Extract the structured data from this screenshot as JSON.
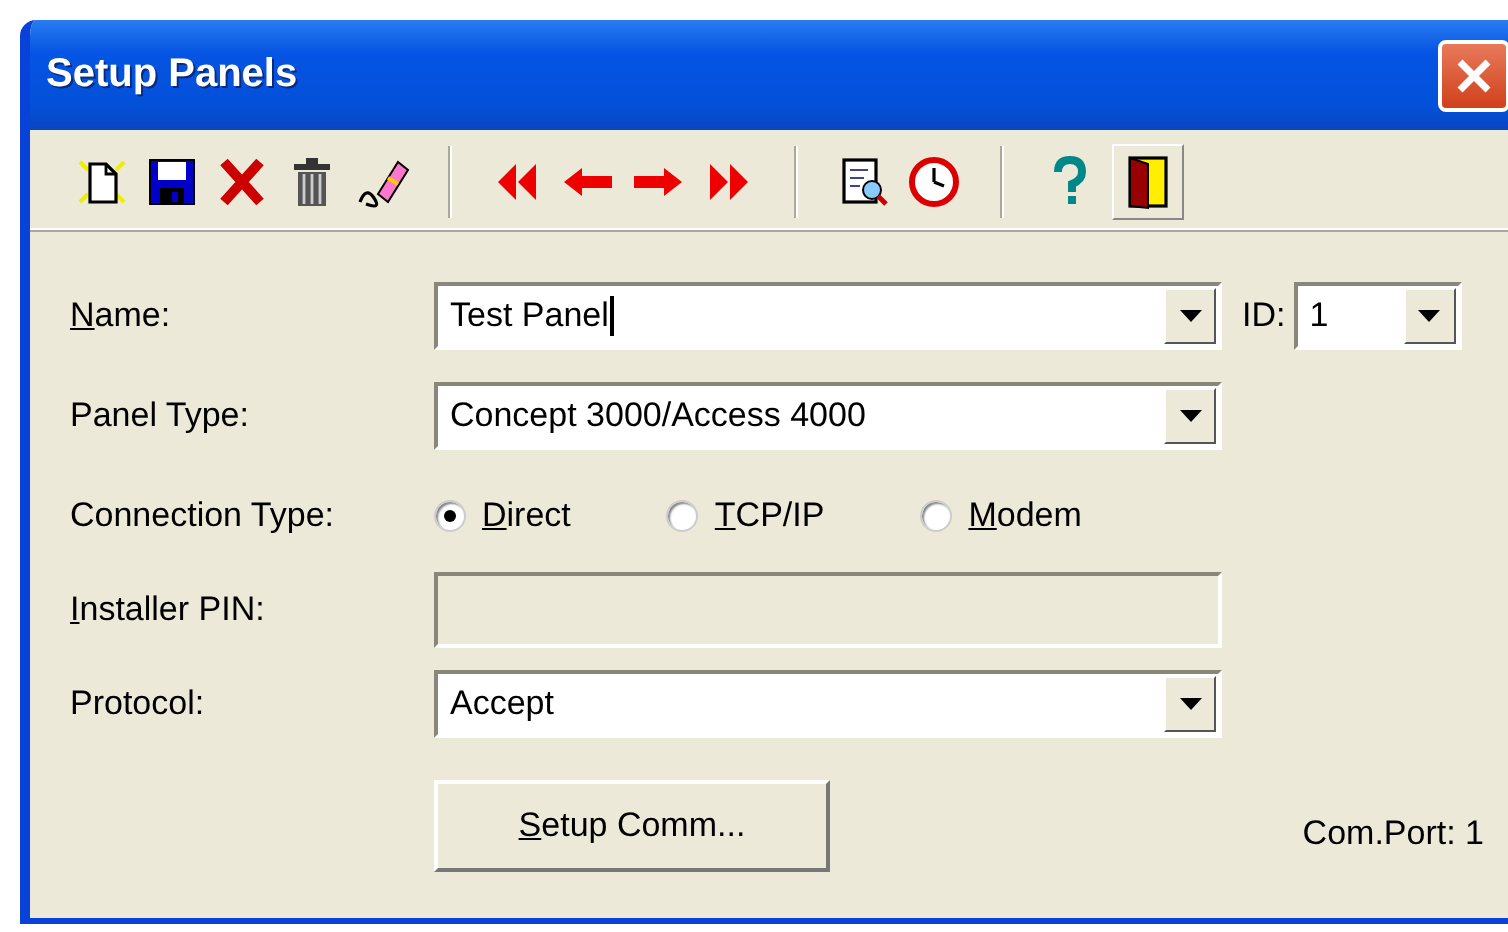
{
  "window": {
    "title": "Setup Panels"
  },
  "form": {
    "name": {
      "label": "Name:",
      "mnemonic": true,
      "value": "Test Panel",
      "focused": true
    },
    "id": {
      "label": "ID:",
      "mnemonic": false,
      "value": "1"
    },
    "panel_type": {
      "label": "Panel Type:",
      "mnemonic": false,
      "value": "Concept 3000/Access 4000"
    },
    "connection": {
      "label": "Connection Type:",
      "mnemonic": false,
      "options": [
        {
          "label": "Direct",
          "mnemonic": true,
          "selected": true
        },
        {
          "label": "TCP/IP",
          "mnemonic": true,
          "selected": false
        },
        {
          "label": "Modem",
          "mnemonic": true,
          "selected": false
        }
      ]
    },
    "installer_pin": {
      "label": "Installer PIN:",
      "mnemonic": true,
      "disabled": true
    },
    "protocol": {
      "label": "Protocol:",
      "mnemonic": false,
      "value": "Accept"
    },
    "setup_button": {
      "label": "Setup Comm...",
      "mnemonic": true
    },
    "com_port": "Com.Port: 1"
  }
}
